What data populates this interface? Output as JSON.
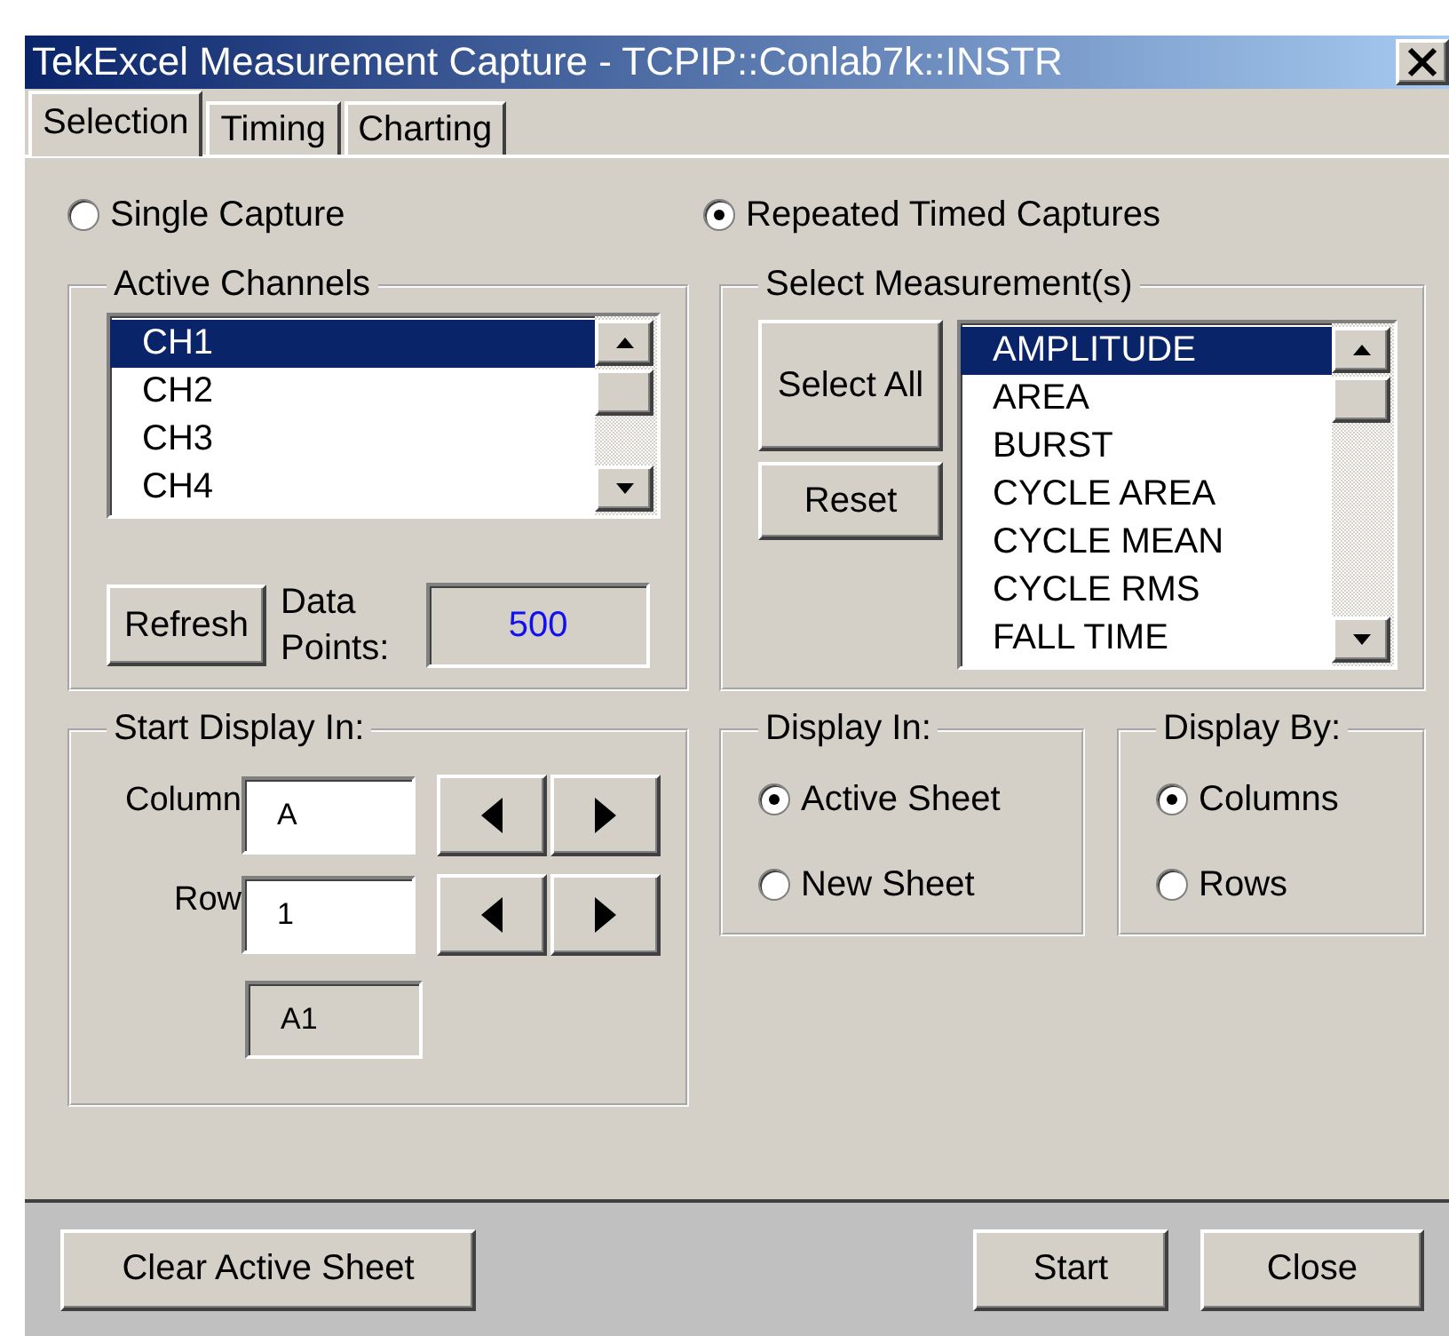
{
  "window": {
    "title": "TekExcel Measurement Capture - TCPIP::Conlab7k::INSTR"
  },
  "tabs": [
    {
      "label": "Selection",
      "selected": true
    },
    {
      "label": "Timing",
      "selected": false
    },
    {
      "label": "Charting",
      "selected": false
    }
  ],
  "capture_mode": [
    {
      "label": "Single Capture",
      "selected": false
    },
    {
      "label": "Repeated Timed Captures",
      "selected": true
    }
  ],
  "active_channels": {
    "title": "Active Channels",
    "items": [
      {
        "label": "CH1",
        "selected": true
      },
      {
        "label": "CH2",
        "selected": false
      },
      {
        "label": "CH3",
        "selected": false
      },
      {
        "label": "CH4",
        "selected": false
      }
    ],
    "refresh_button": "Refresh",
    "data_points_label": "Data Points:",
    "data_points_value": "500"
  },
  "measurements": {
    "title": "Select Measurement(s)",
    "select_all_button": "Select All",
    "reset_button": "Reset",
    "items": [
      {
        "label": "AMPLITUDE",
        "selected": true
      },
      {
        "label": "AREA",
        "selected": false
      },
      {
        "label": "BURST",
        "selected": false
      },
      {
        "label": "CYCLE AREA",
        "selected": false
      },
      {
        "label": "CYCLE MEAN",
        "selected": false
      },
      {
        "label": "CYCLE RMS",
        "selected": false
      },
      {
        "label": "FALL TIME",
        "selected": false
      }
    ]
  },
  "start_display": {
    "title": "Start Display In:",
    "column_label": "Column",
    "column_value": "A",
    "row_label": "Row",
    "row_value": "1",
    "cell_value": "A1"
  },
  "display_in": {
    "title": "Display In:",
    "options": [
      {
        "label": "Active Sheet",
        "selected": true
      },
      {
        "label": "New Sheet",
        "selected": false
      }
    ]
  },
  "display_by": {
    "title": "Display By:",
    "options": [
      {
        "label": "Columns",
        "selected": true
      },
      {
        "label": "Rows",
        "selected": false
      }
    ]
  },
  "footer_buttons": [
    "Clear Active Sheet",
    "Start",
    "Close"
  ]
}
